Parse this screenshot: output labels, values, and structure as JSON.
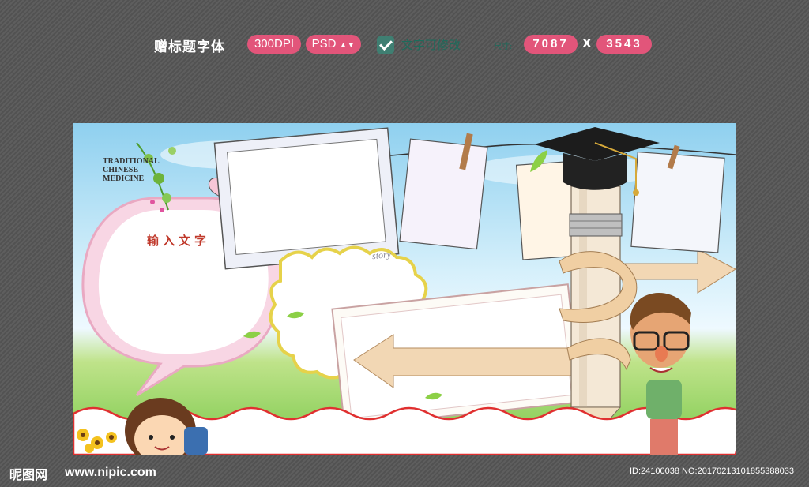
{
  "toolbar": {
    "font_label": "赠标题字体",
    "dpi": "300DPI",
    "format": "PSD",
    "layers_label": "文字可修改",
    "size_label": "尺寸:",
    "width": "7087",
    "separator": "X",
    "height": "3543"
  },
  "poster": {
    "logo_title_line1": "TRADITIONAL",
    "logo_title_line2": "CHINESE",
    "logo_title_line3": "MEDICINE",
    "bubble_title": "输入文字",
    "story_label": "story"
  },
  "footer": {
    "site_logo": "昵图网",
    "site_url": "www.nipic.com",
    "image_id": "ID:24100038 NO:20170213101855388033"
  },
  "colors": {
    "accent_pink": "#e2557a",
    "check_green": "#3f7f72"
  },
  "icons": [
    "checkbox-checked-icon",
    "dropdown-arrows-icon"
  ]
}
